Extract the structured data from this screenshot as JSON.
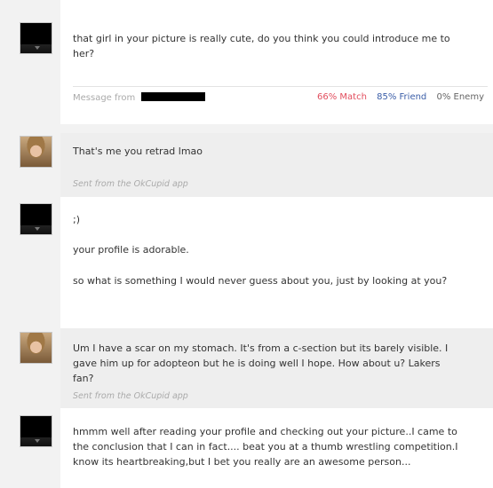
{
  "thread": {
    "m1": {
      "text": "that girl in your picture is really cute, do you think you could introduce me to her?",
      "from_label": "Message from",
      "match": "66% Match",
      "friend": "85% Friend",
      "enemy": "0% Enemy"
    },
    "m2": {
      "text": "That's me you retrad lmao",
      "sent_from": "Sent from the OkCupid app"
    },
    "m3": {
      "line1": ";)",
      "line2": "your profile is adorable.",
      "line3": "so what is something I would never guess about you, just by looking at you?"
    },
    "m4": {
      "text": "Um I have a scar on my stomach. It's from a c-section but its barely visible. I gave him up for adopteon but he is doing well I hope. How about u? Lakers fan?",
      "sent_from": "Sent from the OkCupid app"
    },
    "m5": {
      "text": "hmmm well after reading your profile and checking out your picture..I came to the conclusion that I can in fact.... beat you at a thumb wrestling competition.I know its heartbreaking,but I bet you really are an awesome person..."
    }
  },
  "colors": {
    "match": "#e24e5e",
    "friend": "#3b5ea8",
    "enemy": "#666666"
  }
}
